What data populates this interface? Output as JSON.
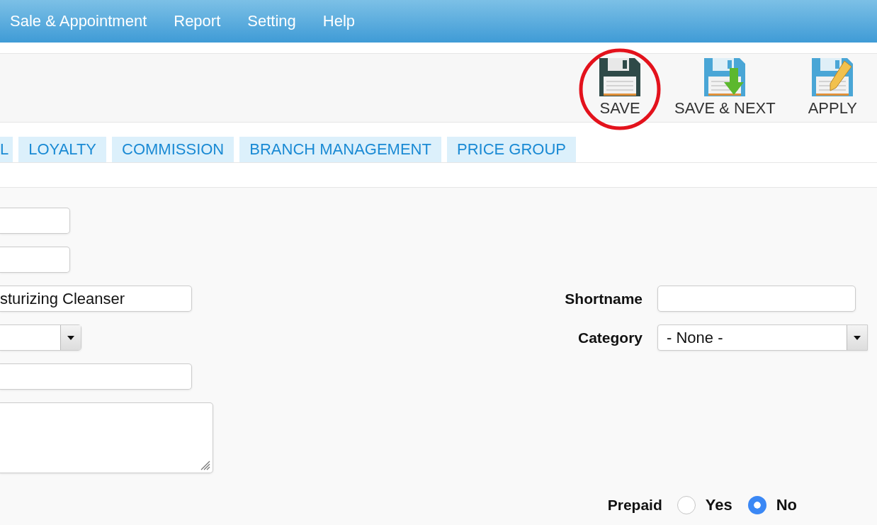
{
  "nav": [
    "Sale & Appointment",
    "Report",
    "Setting",
    "Help"
  ],
  "toolbar": [
    {
      "label": "SAVE",
      "kind": "save",
      "highlighted": true
    },
    {
      "label": "SAVE & NEXT",
      "kind": "save-next",
      "highlighted": false
    },
    {
      "label": "APPLY",
      "kind": "apply",
      "highlighted": false
    }
  ],
  "tabs": [
    {
      "label": "L",
      "selected": false
    },
    {
      "label": "LOYALTY",
      "selected": false
    },
    {
      "label": "COMMISSION",
      "selected": false
    },
    {
      "label": "BRANCH MANAGEMENT",
      "selected": false
    },
    {
      "label": "PRICE GROUP",
      "selected": false
    }
  ],
  "left_fields": [
    {
      "kind": "input"
    },
    {
      "kind": "input"
    },
    {
      "kind": "input",
      "value": "sturizing Cleanser"
    },
    {
      "kind": "select"
    },
    {
      "kind": "input"
    },
    {
      "kind": "textarea"
    }
  ],
  "shortname": {
    "label": "Shortname"
  },
  "category": {
    "label": "Category",
    "value": "- None -"
  },
  "prepaid": {
    "label": "Prepaid",
    "options": [
      {
        "label": "Yes",
        "selected": false
      },
      {
        "label": "No",
        "selected": true
      }
    ]
  }
}
